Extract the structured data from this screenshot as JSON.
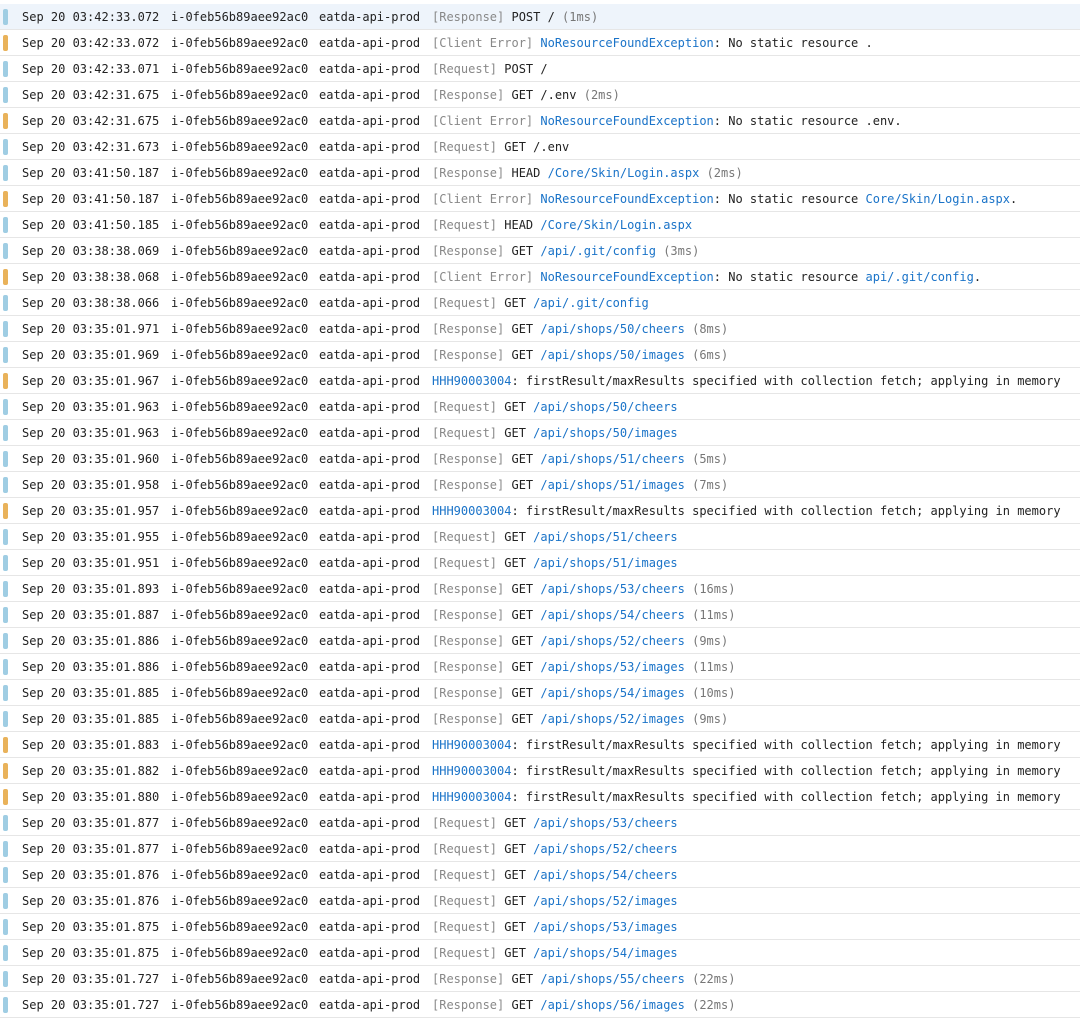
{
  "colors": {
    "level_info": "#9fcde3",
    "level_warn": "#e9b25a",
    "link": "#1a73c8",
    "tag": "#888888",
    "row_selected": "#eef4fb"
  },
  "rows": [
    {
      "level": "info",
      "selected": true,
      "time": "Sep 20 03:42:33.072",
      "instance": "i-0feb56b89aee92ac0",
      "service": "eatda-api-prod",
      "parts": [
        {
          "t": "tag",
          "v": "[Response]"
        },
        {
          "t": "plain",
          "v": " POST / "
        },
        {
          "t": "dur",
          "v": "(1ms)"
        }
      ]
    },
    {
      "level": "warn",
      "time": "Sep 20 03:42:33.072",
      "instance": "i-0feb56b89aee92ac0",
      "service": "eatda-api-prod",
      "parts": [
        {
          "t": "tag",
          "v": "[Client Error]"
        },
        {
          "t": "plain",
          "v": " "
        },
        {
          "t": "link",
          "v": "NoResourceFoundException"
        },
        {
          "t": "plain",
          "v": ": No static resource ."
        }
      ]
    },
    {
      "level": "info",
      "time": "Sep 20 03:42:33.071",
      "instance": "i-0feb56b89aee92ac0",
      "service": "eatda-api-prod",
      "parts": [
        {
          "t": "tag",
          "v": "[Request]"
        },
        {
          "t": "plain",
          "v": " POST /"
        }
      ]
    },
    {
      "level": "info",
      "time": "Sep 20 03:42:31.675",
      "instance": "i-0feb56b89aee92ac0",
      "service": "eatda-api-prod",
      "parts": [
        {
          "t": "tag",
          "v": "[Response]"
        },
        {
          "t": "plain",
          "v": " GET /.env "
        },
        {
          "t": "dur",
          "v": "(2ms)"
        }
      ]
    },
    {
      "level": "warn",
      "time": "Sep 20 03:42:31.675",
      "instance": "i-0feb56b89aee92ac0",
      "service": "eatda-api-prod",
      "parts": [
        {
          "t": "tag",
          "v": "[Client Error]"
        },
        {
          "t": "plain",
          "v": " "
        },
        {
          "t": "link",
          "v": "NoResourceFoundException"
        },
        {
          "t": "plain",
          "v": ": No static resource .env."
        }
      ]
    },
    {
      "level": "info",
      "time": "Sep 20 03:42:31.673",
      "instance": "i-0feb56b89aee92ac0",
      "service": "eatda-api-prod",
      "parts": [
        {
          "t": "tag",
          "v": "[Request]"
        },
        {
          "t": "plain",
          "v": " GET /.env"
        }
      ]
    },
    {
      "level": "info",
      "time": "Sep 20 03:41:50.187",
      "instance": "i-0feb56b89aee92ac0",
      "service": "eatda-api-prod",
      "parts": [
        {
          "t": "tag",
          "v": "[Response]"
        },
        {
          "t": "plain",
          "v": " HEAD "
        },
        {
          "t": "link",
          "v": "/Core/Skin/Login.aspx"
        },
        {
          "t": "plain",
          "v": " "
        },
        {
          "t": "dur",
          "v": "(2ms)"
        }
      ]
    },
    {
      "level": "warn",
      "time": "Sep 20 03:41:50.187",
      "instance": "i-0feb56b89aee92ac0",
      "service": "eatda-api-prod",
      "parts": [
        {
          "t": "tag",
          "v": "[Client Error]"
        },
        {
          "t": "plain",
          "v": " "
        },
        {
          "t": "link",
          "v": "NoResourceFoundException"
        },
        {
          "t": "plain",
          "v": ": No static resource "
        },
        {
          "t": "link",
          "v": "Core/Skin/Login.aspx"
        },
        {
          "t": "plain",
          "v": "."
        }
      ]
    },
    {
      "level": "info",
      "time": "Sep 20 03:41:50.185",
      "instance": "i-0feb56b89aee92ac0",
      "service": "eatda-api-prod",
      "parts": [
        {
          "t": "tag",
          "v": "[Request]"
        },
        {
          "t": "plain",
          "v": " HEAD "
        },
        {
          "t": "link",
          "v": "/Core/Skin/Login.aspx"
        }
      ]
    },
    {
      "level": "info",
      "time": "Sep 20 03:38:38.069",
      "instance": "i-0feb56b89aee92ac0",
      "service": "eatda-api-prod",
      "parts": [
        {
          "t": "tag",
          "v": "[Response]"
        },
        {
          "t": "plain",
          "v": " GET "
        },
        {
          "t": "link",
          "v": "/api/.git/config"
        },
        {
          "t": "plain",
          "v": " "
        },
        {
          "t": "dur",
          "v": "(3ms)"
        }
      ]
    },
    {
      "level": "warn",
      "time": "Sep 20 03:38:38.068",
      "instance": "i-0feb56b89aee92ac0",
      "service": "eatda-api-prod",
      "parts": [
        {
          "t": "tag",
          "v": "[Client Error]"
        },
        {
          "t": "plain",
          "v": " "
        },
        {
          "t": "link",
          "v": "NoResourceFoundException"
        },
        {
          "t": "plain",
          "v": ": No static resource "
        },
        {
          "t": "link",
          "v": "api/.git/config"
        },
        {
          "t": "plain",
          "v": "."
        }
      ]
    },
    {
      "level": "info",
      "time": "Sep 20 03:38:38.066",
      "instance": "i-0feb56b89aee92ac0",
      "service": "eatda-api-prod",
      "parts": [
        {
          "t": "tag",
          "v": "[Request]"
        },
        {
          "t": "plain",
          "v": " GET "
        },
        {
          "t": "link",
          "v": "/api/.git/config"
        }
      ]
    },
    {
      "level": "info",
      "time": "Sep 20 03:35:01.971",
      "instance": "i-0feb56b89aee92ac0",
      "service": "eatda-api-prod",
      "parts": [
        {
          "t": "tag",
          "v": "[Response]"
        },
        {
          "t": "plain",
          "v": " GET "
        },
        {
          "t": "link",
          "v": "/api/shops/50/cheers"
        },
        {
          "t": "plain",
          "v": " "
        },
        {
          "t": "dur",
          "v": "(8ms)"
        }
      ]
    },
    {
      "level": "info",
      "time": "Sep 20 03:35:01.969",
      "instance": "i-0feb56b89aee92ac0",
      "service": "eatda-api-prod",
      "parts": [
        {
          "t": "tag",
          "v": "[Response]"
        },
        {
          "t": "plain",
          "v": " GET "
        },
        {
          "t": "link",
          "v": "/api/shops/50/images"
        },
        {
          "t": "plain",
          "v": " "
        },
        {
          "t": "dur",
          "v": "(6ms)"
        }
      ]
    },
    {
      "level": "warn",
      "time": "Sep 20 03:35:01.967",
      "instance": "i-0feb56b89aee92ac0",
      "service": "eatda-api-prod",
      "parts": [
        {
          "t": "link",
          "v": "HHH90003004"
        },
        {
          "t": "plain",
          "v": ": firstResult/maxResults specified with collection fetch; applying in memory"
        }
      ]
    },
    {
      "level": "info",
      "time": "Sep 20 03:35:01.963",
      "instance": "i-0feb56b89aee92ac0",
      "service": "eatda-api-prod",
      "parts": [
        {
          "t": "tag",
          "v": "[Request]"
        },
        {
          "t": "plain",
          "v": " GET "
        },
        {
          "t": "link",
          "v": "/api/shops/50/cheers"
        }
      ]
    },
    {
      "level": "info",
      "time": "Sep 20 03:35:01.963",
      "instance": "i-0feb56b89aee92ac0",
      "service": "eatda-api-prod",
      "parts": [
        {
          "t": "tag",
          "v": "[Request]"
        },
        {
          "t": "plain",
          "v": " GET "
        },
        {
          "t": "link",
          "v": "/api/shops/50/images"
        }
      ]
    },
    {
      "level": "info",
      "time": "Sep 20 03:35:01.960",
      "instance": "i-0feb56b89aee92ac0",
      "service": "eatda-api-prod",
      "parts": [
        {
          "t": "tag",
          "v": "[Response]"
        },
        {
          "t": "plain",
          "v": " GET "
        },
        {
          "t": "link",
          "v": "/api/shops/51/cheers"
        },
        {
          "t": "plain",
          "v": " "
        },
        {
          "t": "dur",
          "v": "(5ms)"
        }
      ]
    },
    {
      "level": "info",
      "time": "Sep 20 03:35:01.958",
      "instance": "i-0feb56b89aee92ac0",
      "service": "eatda-api-prod",
      "parts": [
        {
          "t": "tag",
          "v": "[Response]"
        },
        {
          "t": "plain",
          "v": " GET "
        },
        {
          "t": "link",
          "v": "/api/shops/51/images"
        },
        {
          "t": "plain",
          "v": " "
        },
        {
          "t": "dur",
          "v": "(7ms)"
        }
      ]
    },
    {
      "level": "warn",
      "time": "Sep 20 03:35:01.957",
      "instance": "i-0feb56b89aee92ac0",
      "service": "eatda-api-prod",
      "parts": [
        {
          "t": "link",
          "v": "HHH90003004"
        },
        {
          "t": "plain",
          "v": ": firstResult/maxResults specified with collection fetch; applying in memory"
        }
      ]
    },
    {
      "level": "info",
      "time": "Sep 20 03:35:01.955",
      "instance": "i-0feb56b89aee92ac0",
      "service": "eatda-api-prod",
      "parts": [
        {
          "t": "tag",
          "v": "[Request]"
        },
        {
          "t": "plain",
          "v": " GET "
        },
        {
          "t": "link",
          "v": "/api/shops/51/cheers"
        }
      ]
    },
    {
      "level": "info",
      "time": "Sep 20 03:35:01.951",
      "instance": "i-0feb56b89aee92ac0",
      "service": "eatda-api-prod",
      "parts": [
        {
          "t": "tag",
          "v": "[Request]"
        },
        {
          "t": "plain",
          "v": " GET "
        },
        {
          "t": "link",
          "v": "/api/shops/51/images"
        }
      ]
    },
    {
      "level": "info",
      "time": "Sep 20 03:35:01.893",
      "instance": "i-0feb56b89aee92ac0",
      "service": "eatda-api-prod",
      "parts": [
        {
          "t": "tag",
          "v": "[Response]"
        },
        {
          "t": "plain",
          "v": " GET "
        },
        {
          "t": "link",
          "v": "/api/shops/53/cheers"
        },
        {
          "t": "plain",
          "v": " "
        },
        {
          "t": "dur",
          "v": "(16ms)"
        }
      ]
    },
    {
      "level": "info",
      "time": "Sep 20 03:35:01.887",
      "instance": "i-0feb56b89aee92ac0",
      "service": "eatda-api-prod",
      "parts": [
        {
          "t": "tag",
          "v": "[Response]"
        },
        {
          "t": "plain",
          "v": " GET "
        },
        {
          "t": "link",
          "v": "/api/shops/54/cheers"
        },
        {
          "t": "plain",
          "v": " "
        },
        {
          "t": "dur",
          "v": "(11ms)"
        }
      ]
    },
    {
      "level": "info",
      "time": "Sep 20 03:35:01.886",
      "instance": "i-0feb56b89aee92ac0",
      "service": "eatda-api-prod",
      "parts": [
        {
          "t": "tag",
          "v": "[Response]"
        },
        {
          "t": "plain",
          "v": " GET "
        },
        {
          "t": "link",
          "v": "/api/shops/52/cheers"
        },
        {
          "t": "plain",
          "v": " "
        },
        {
          "t": "dur",
          "v": "(9ms)"
        }
      ]
    },
    {
      "level": "info",
      "time": "Sep 20 03:35:01.886",
      "instance": "i-0feb56b89aee92ac0",
      "service": "eatda-api-prod",
      "parts": [
        {
          "t": "tag",
          "v": "[Response]"
        },
        {
          "t": "plain",
          "v": " GET "
        },
        {
          "t": "link",
          "v": "/api/shops/53/images"
        },
        {
          "t": "plain",
          "v": " "
        },
        {
          "t": "dur",
          "v": "(11ms)"
        }
      ]
    },
    {
      "level": "info",
      "time": "Sep 20 03:35:01.885",
      "instance": "i-0feb56b89aee92ac0",
      "service": "eatda-api-prod",
      "parts": [
        {
          "t": "tag",
          "v": "[Response]"
        },
        {
          "t": "plain",
          "v": " GET "
        },
        {
          "t": "link",
          "v": "/api/shops/54/images"
        },
        {
          "t": "plain",
          "v": " "
        },
        {
          "t": "dur",
          "v": "(10ms)"
        }
      ]
    },
    {
      "level": "info",
      "time": "Sep 20 03:35:01.885",
      "instance": "i-0feb56b89aee92ac0",
      "service": "eatda-api-prod",
      "parts": [
        {
          "t": "tag",
          "v": "[Response]"
        },
        {
          "t": "plain",
          "v": " GET "
        },
        {
          "t": "link",
          "v": "/api/shops/52/images"
        },
        {
          "t": "plain",
          "v": " "
        },
        {
          "t": "dur",
          "v": "(9ms)"
        }
      ]
    },
    {
      "level": "warn",
      "time": "Sep 20 03:35:01.883",
      "instance": "i-0feb56b89aee92ac0",
      "service": "eatda-api-prod",
      "parts": [
        {
          "t": "link",
          "v": "HHH90003004"
        },
        {
          "t": "plain",
          "v": ": firstResult/maxResults specified with collection fetch; applying in memory"
        }
      ]
    },
    {
      "level": "warn",
      "time": "Sep 20 03:35:01.882",
      "instance": "i-0feb56b89aee92ac0",
      "service": "eatda-api-prod",
      "parts": [
        {
          "t": "link",
          "v": "HHH90003004"
        },
        {
          "t": "plain",
          "v": ": firstResult/maxResults specified with collection fetch; applying in memory"
        }
      ]
    },
    {
      "level": "warn",
      "time": "Sep 20 03:35:01.880",
      "instance": "i-0feb56b89aee92ac0",
      "service": "eatda-api-prod",
      "parts": [
        {
          "t": "link",
          "v": "HHH90003004"
        },
        {
          "t": "plain",
          "v": ": firstResult/maxResults specified with collection fetch; applying in memory"
        }
      ]
    },
    {
      "level": "info",
      "time": "Sep 20 03:35:01.877",
      "instance": "i-0feb56b89aee92ac0",
      "service": "eatda-api-prod",
      "parts": [
        {
          "t": "tag",
          "v": "[Request]"
        },
        {
          "t": "plain",
          "v": " GET "
        },
        {
          "t": "link",
          "v": "/api/shops/53/cheers"
        }
      ]
    },
    {
      "level": "info",
      "time": "Sep 20 03:35:01.877",
      "instance": "i-0feb56b89aee92ac0",
      "service": "eatda-api-prod",
      "parts": [
        {
          "t": "tag",
          "v": "[Request]"
        },
        {
          "t": "plain",
          "v": " GET "
        },
        {
          "t": "link",
          "v": "/api/shops/52/cheers"
        }
      ]
    },
    {
      "level": "info",
      "time": "Sep 20 03:35:01.876",
      "instance": "i-0feb56b89aee92ac0",
      "service": "eatda-api-prod",
      "parts": [
        {
          "t": "tag",
          "v": "[Request]"
        },
        {
          "t": "plain",
          "v": " GET "
        },
        {
          "t": "link",
          "v": "/api/shops/54/cheers"
        }
      ]
    },
    {
      "level": "info",
      "time": "Sep 20 03:35:01.876",
      "instance": "i-0feb56b89aee92ac0",
      "service": "eatda-api-prod",
      "parts": [
        {
          "t": "tag",
          "v": "[Request]"
        },
        {
          "t": "plain",
          "v": " GET "
        },
        {
          "t": "link",
          "v": "/api/shops/52/images"
        }
      ]
    },
    {
      "level": "info",
      "time": "Sep 20 03:35:01.875",
      "instance": "i-0feb56b89aee92ac0",
      "service": "eatda-api-prod",
      "parts": [
        {
          "t": "tag",
          "v": "[Request]"
        },
        {
          "t": "plain",
          "v": " GET "
        },
        {
          "t": "link",
          "v": "/api/shops/53/images"
        }
      ]
    },
    {
      "level": "info",
      "time": "Sep 20 03:35:01.875",
      "instance": "i-0feb56b89aee92ac0",
      "service": "eatda-api-prod",
      "parts": [
        {
          "t": "tag",
          "v": "[Request]"
        },
        {
          "t": "plain",
          "v": " GET "
        },
        {
          "t": "link",
          "v": "/api/shops/54/images"
        }
      ]
    },
    {
      "level": "info",
      "time": "Sep 20 03:35:01.727",
      "instance": "i-0feb56b89aee92ac0",
      "service": "eatda-api-prod",
      "parts": [
        {
          "t": "tag",
          "v": "[Response]"
        },
        {
          "t": "plain",
          "v": " GET "
        },
        {
          "t": "link",
          "v": "/api/shops/55/cheers"
        },
        {
          "t": "plain",
          "v": " "
        },
        {
          "t": "dur",
          "v": "(22ms)"
        }
      ]
    },
    {
      "level": "info",
      "time": "Sep 20 03:35:01.727",
      "instance": "i-0feb56b89aee92ac0",
      "service": "eatda-api-prod",
      "parts": [
        {
          "t": "tag",
          "v": "[Response]"
        },
        {
          "t": "plain",
          "v": " GET "
        },
        {
          "t": "link",
          "v": "/api/shops/56/images"
        },
        {
          "t": "plain",
          "v": " "
        },
        {
          "t": "dur",
          "v": "(22ms)"
        }
      ]
    }
  ]
}
